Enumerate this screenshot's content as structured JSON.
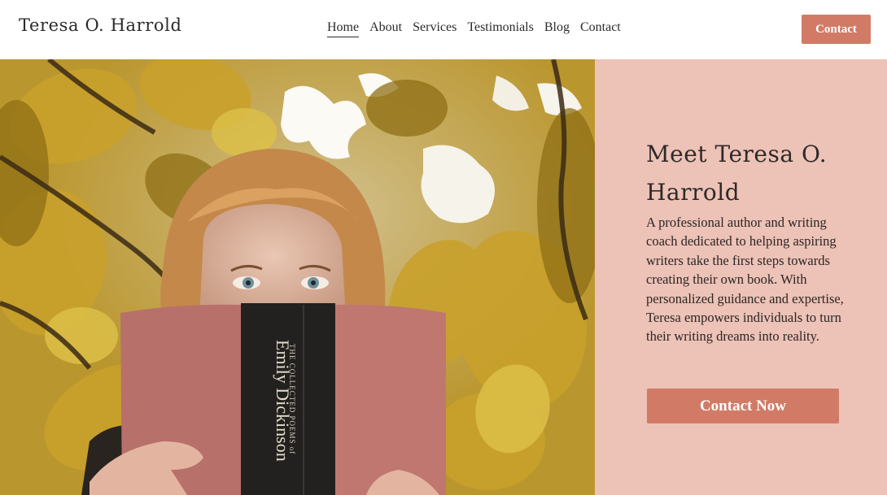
{
  "header": {
    "brand": "Teresa O. Harrold",
    "nav": [
      {
        "label": "Home",
        "active": true
      },
      {
        "label": "About",
        "active": false
      },
      {
        "label": "Services",
        "active": false
      },
      {
        "label": "Testimonials",
        "active": false
      },
      {
        "label": "Blog",
        "active": false
      },
      {
        "label": "Contact",
        "active": false
      }
    ],
    "cta_label": "Contact"
  },
  "hero": {
    "photo": {
      "book_spine_line1": "THE COLLECTED POEMS of",
      "book_spine_line2": "Emily Dickinson"
    },
    "title": "Meet Teresa O. Harrold",
    "description": "A professional author and writing coach dedicated to helping aspiring writers take the first steps towards creating their own book. With personalized guidance and expertise, Teresa empowers individuals to turn their writing dreams into reality.",
    "cta_label": "Contact Now"
  },
  "colors": {
    "accent": "#d17b66",
    "panel_background": "#edc2b7",
    "text": "#2b2b2b"
  }
}
